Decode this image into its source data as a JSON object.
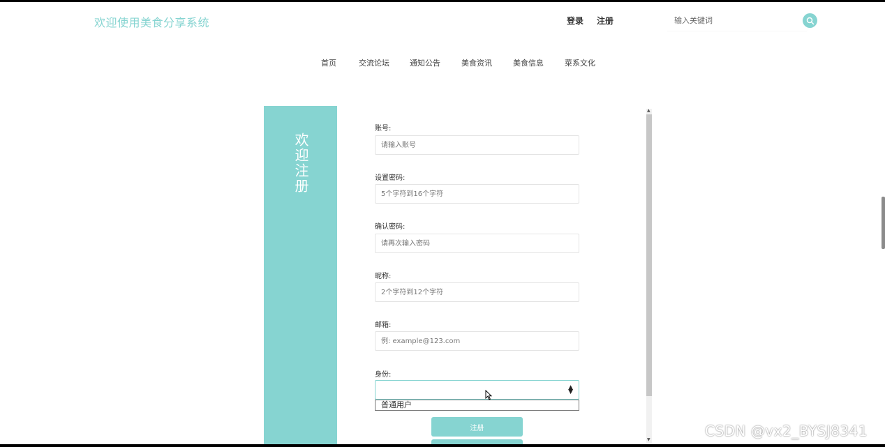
{
  "header": {
    "site_title": "欢迎使用美食分享系统",
    "login_label": "登录",
    "register_label": "注册",
    "search_placeholder": "输入关键词",
    "search_icon": "search-icon"
  },
  "nav": {
    "items": [
      {
        "label": "首页"
      },
      {
        "label": "交流论坛"
      },
      {
        "label": "通知公告"
      },
      {
        "label": "美食资讯"
      },
      {
        "label": "美食信息"
      },
      {
        "label": "菜系文化"
      }
    ]
  },
  "panel": {
    "title": "欢迎注册"
  },
  "form": {
    "account_label": "账号:",
    "account_placeholder": "请输入账号",
    "password_label": "设置密码:",
    "password_placeholder": "5个字符到16个字符",
    "confirm_label": "确认密码:",
    "confirm_placeholder": "请再次输入密码",
    "nickname_label": "昵称:",
    "nickname_placeholder": "2个字符到12个字符",
    "email_label": "邮箱:",
    "email_placeholder": "例: example@123.com",
    "identity_label": "身份:",
    "identity_selected": "",
    "identity_options": [
      "普通用户"
    ],
    "submit_label": "注册"
  },
  "watermark": "CSDN @vx2_BYSJ8341",
  "colors": {
    "accent": "#86d4d1",
    "text": "#333333"
  }
}
